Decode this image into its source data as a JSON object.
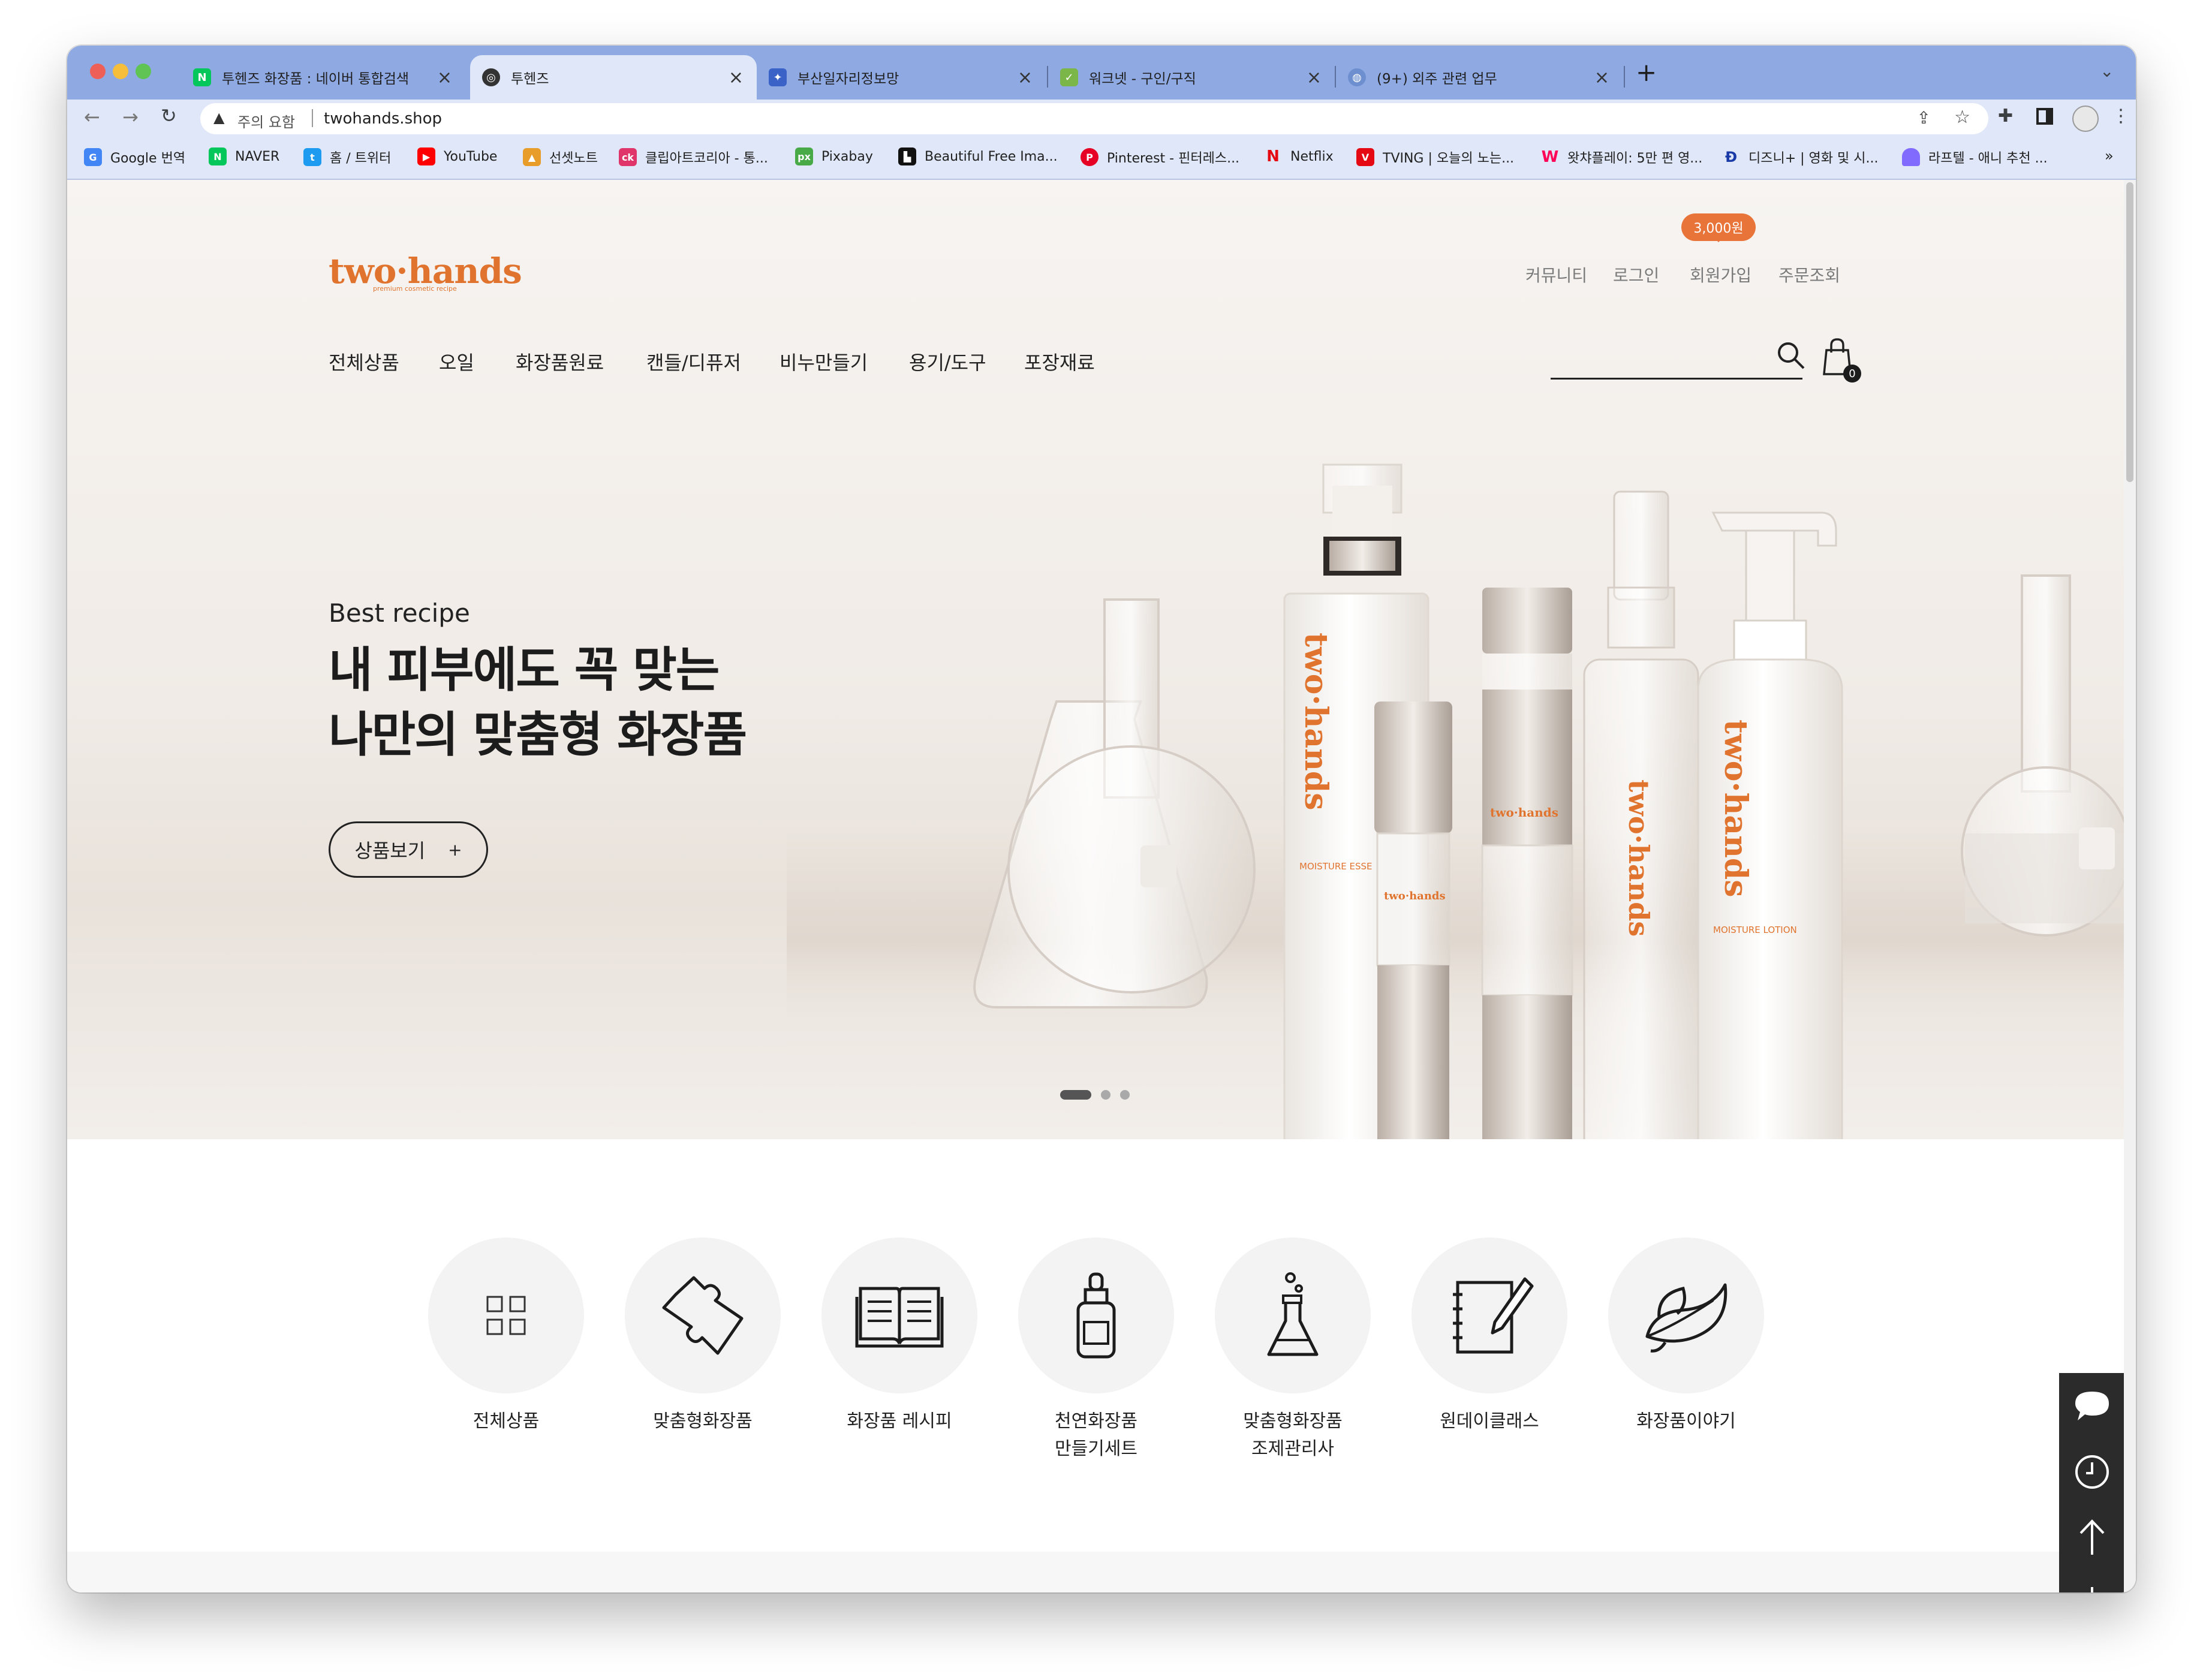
{
  "browser": {
    "tabs": [
      {
        "title": "투헨즈 화장품 : 네이버 통합검색",
        "favicon": "naver-icon",
        "active": false
      },
      {
        "title": "투헨즈",
        "favicon": "globe-icon",
        "active": true
      },
      {
        "title": "부산일자리정보망",
        "favicon": "busan-jobs-icon",
        "active": false
      },
      {
        "title": "워크넷 - 구인/구직",
        "favicon": "worknet-icon",
        "active": false
      },
      {
        "title": "(9+) 외주 관련 업무",
        "favicon": "globe-icon",
        "active": false
      }
    ],
    "new_tab": "+",
    "address": {
      "security_label": "주의 요함",
      "url": "twohands.shop"
    },
    "bookmarks": [
      "Google 번역",
      "NAVER",
      "홈 / 트위터",
      "YouTube",
      "선셋노트",
      "클립아트코리아 - 통...",
      "Pixabay",
      "Beautiful Free Ima...",
      "Pinterest - 핀터레스...",
      "Netflix",
      "TVING | 오늘의 노는...",
      "왓챠플레이: 5만 편 영...",
      "디즈니+ | 영화 및 시...",
      "라프텔 - 애니 추천 ..."
    ],
    "bookmarks_more": "»",
    "colors": {
      "tabbar": "#8fa9e3",
      "toolbar": "#dfe7f8"
    }
  },
  "site": {
    "logo": "two·hands",
    "logo_sub": "premium cosmetic recipe",
    "util_links": [
      "커뮤니티",
      "로그인",
      "회원가입",
      "주문조회"
    ],
    "signup_badge": "3,000원",
    "nav": [
      "전체상품",
      "오일",
      "화장품원료",
      "캔들/디퓨저",
      "비누만들기",
      "용기/도구",
      "포장재료"
    ],
    "cart_count": "0",
    "accent": "#e0742f"
  },
  "hero": {
    "subtitle": "Best recipe",
    "title_line1": "내 피부에도 꼭 맞는",
    "title_line2": "나만의 맞춤형 화장품",
    "button_label": "상품보기",
    "button_icon": "+",
    "slides": 3,
    "active_slide": 1,
    "product_labels": [
      "two·hands",
      "two·hands",
      "two·hands",
      "two·hands",
      "two·hands"
    ],
    "product_names": [
      "MOISTURE ESSE",
      "MOISTURE LOTION"
    ]
  },
  "categories": [
    {
      "icon": "grid-icon",
      "label1": "전체상품",
      "label2": ""
    },
    {
      "icon": "puzzle-icon",
      "label1": "맞춤형화장품",
      "label2": ""
    },
    {
      "icon": "book-icon",
      "label1": "화장품 레시피",
      "label2": ""
    },
    {
      "icon": "dropper-bottle-icon",
      "label1": "천연화장품",
      "label2": "만들기세트"
    },
    {
      "icon": "flask-icon",
      "label1": "맞춤형화장품",
      "label2": "조제관리사"
    },
    {
      "icon": "notebook-pen-icon",
      "label1": "원데이클래스",
      "label2": ""
    },
    {
      "icon": "leaf-icon",
      "label1": "화장품이야기",
      "label2": ""
    }
  ],
  "quick_menu": [
    "chat-icon",
    "clock-icon",
    "arrow-up-icon",
    "arrow-down-icon"
  ]
}
